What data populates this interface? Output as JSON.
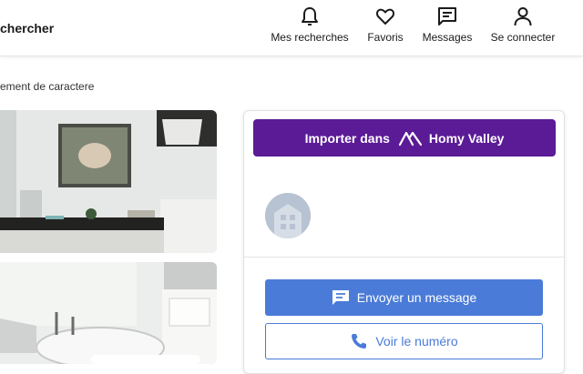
{
  "header": {
    "search_label": "chercher",
    "nav": [
      {
        "label": "Mes recherches",
        "icon": "bell-icon"
      },
      {
        "label": "Favoris",
        "icon": "heart-icon"
      },
      {
        "label": "Messages",
        "icon": "message-icon"
      },
      {
        "label": "Se connecter",
        "icon": "user-icon"
      }
    ]
  },
  "breadcrumb": "ement de caractere",
  "photos": [
    {
      "description": "bathroom-with-painting"
    },
    {
      "description": "bathroom-with-bathtub"
    }
  ],
  "contact_card": {
    "import_label": "Importer dans",
    "import_brand": "Homy Valley",
    "message_button": "Envoyer un message",
    "phone_button": "Voir le numéro"
  },
  "colors": {
    "brand_purple": "#5b1b96",
    "primary_blue": "#4a7bd8"
  }
}
